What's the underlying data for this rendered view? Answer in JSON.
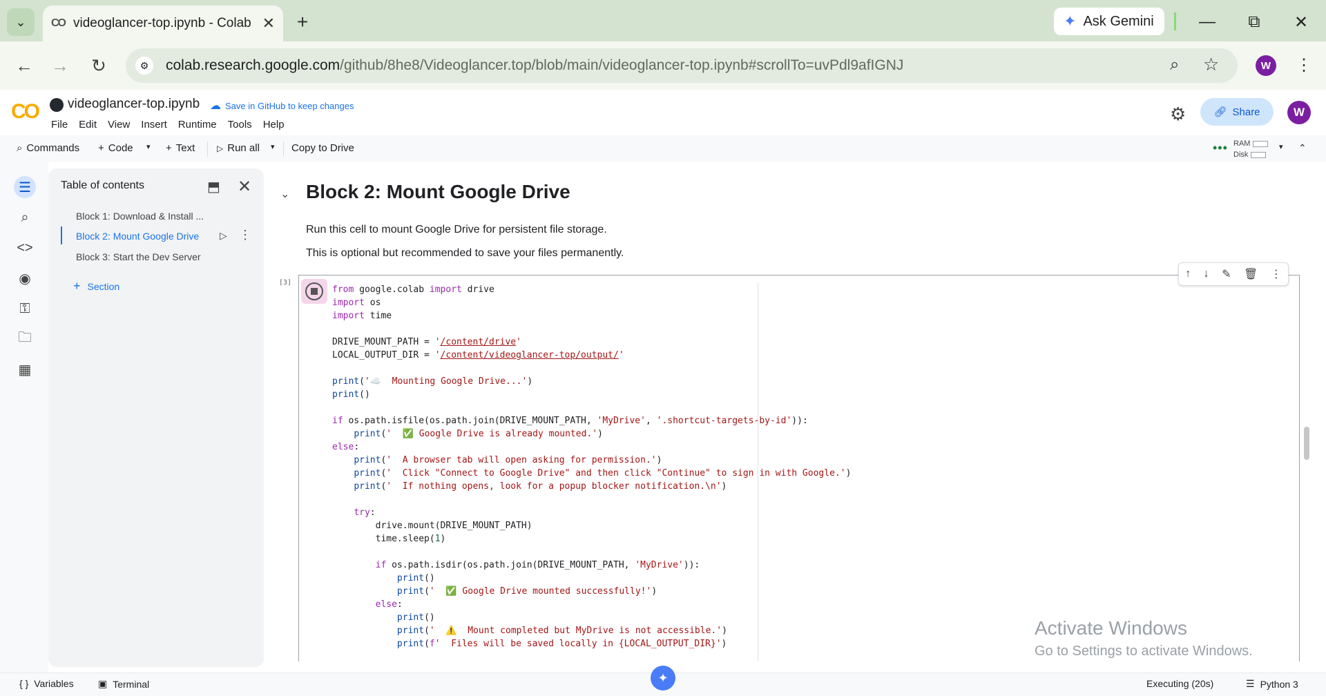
{
  "browser": {
    "tab_title": "videoglancer-top.ipynb - Colab",
    "new_tab": "+",
    "ask_gemini": "Ask Gemini",
    "url_host": "colab.research.google.com",
    "url_path": "/github/8he8/Videoglancer.top/blob/main/videoglancer-top.ipynb#scrollTo=uvPdl9afIGNJ",
    "avatar_letter": "W"
  },
  "colab": {
    "notebook_name": "videoglancer-top.ipynb",
    "save_github": "Save in GitHub to keep changes",
    "menu": [
      "File",
      "Edit",
      "View",
      "Insert",
      "Runtime",
      "Tools",
      "Help"
    ],
    "share": "Share",
    "avatar_letter": "W"
  },
  "toolbar": {
    "commands": "Commands",
    "code": "Code",
    "text": "Text",
    "run_all": "Run all",
    "copy_to_drive": "Copy to Drive",
    "ram": "RAM",
    "disk": "Disk"
  },
  "toc": {
    "title": "Table of contents",
    "items": [
      "Block 1: Download & Install ...",
      "Block 2: Mount Google Drive",
      "Block 3: Start the Dev Server"
    ],
    "section": "Section"
  },
  "notebook": {
    "heading": "Block 2: Mount Google Drive",
    "para1": "Run this cell to mount Google Drive for persistent file storage.",
    "para2": "This is optional but recommended to save your files permanently.",
    "exec_count": "[3]"
  },
  "watermark": {
    "line1": "Activate Windows",
    "line2": "Go to Settings to activate Windows."
  },
  "statusbar": {
    "variables": "Variables",
    "terminal": "Terminal",
    "executing": "Executing (20s)",
    "python": "Python 3"
  }
}
